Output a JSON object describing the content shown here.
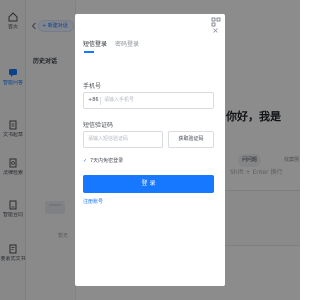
{
  "nav": {
    "items": [
      {
        "label": "首页",
        "icon": "home-icon"
      },
      {
        "label": "智能问答",
        "icon": "chat-icon"
      },
      {
        "label": "文书起草",
        "icon": "document-icon"
      },
      {
        "label": "法律检索",
        "icon": "search-icon"
      },
      {
        "label": "智能合同",
        "icon": "contract-icon"
      },
      {
        "label": "要素式文书",
        "icon": "form-icon"
      }
    ],
    "active_index": 1
  },
  "history": {
    "new_chat_label": "新建对话",
    "title": "历史对话",
    "empty_text": "暂无"
  },
  "main": {
    "greeting": "你好，我是",
    "input_hint": "Shift + Enter 换行",
    "chips": [
      "问问题",
      "找案例"
    ]
  },
  "login": {
    "tabs": [
      "短信登录",
      "密码登录"
    ],
    "active_tab": 0,
    "phone_label": "手机号",
    "phone_prefix": "+86",
    "phone_placeholder": "请输入手机号",
    "code_label": "短信验证码",
    "code_placeholder": "请输入短信验证码",
    "get_code_label": "获取验证码",
    "remember_label": "7天内免密登录",
    "remember_checked": true,
    "submit_label": "登 录",
    "register_label": "注册账号"
  },
  "colors": {
    "accent": "#1677ff",
    "overlay": "rgba(0,0,0,0.45)"
  }
}
